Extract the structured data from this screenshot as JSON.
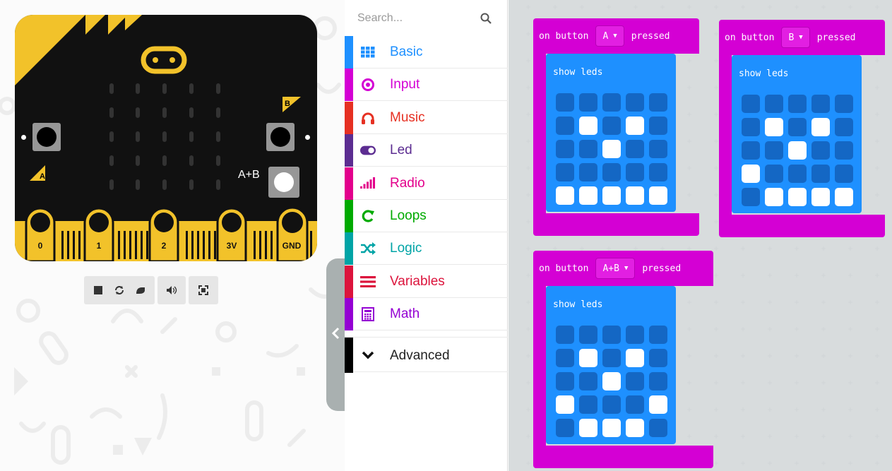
{
  "simulator": {
    "board_pins": [
      "0",
      "1",
      "2",
      "3V",
      "GND"
    ],
    "button_a_label": "A",
    "button_b_label": "B",
    "button_ab_label": "A+B",
    "colors": {
      "board": "#111111",
      "accent": "#f2c22a"
    },
    "toolbar_icons": [
      "stop-icon",
      "restart-icon",
      "slowmo-icon",
      "mute-icon",
      "fullscreen-icon"
    ]
  },
  "toolbox": {
    "search_placeholder": "Search...",
    "categories": [
      {
        "label": "Basic",
        "color": "#1e90ff",
        "icon": "grid-icon"
      },
      {
        "label": "Input",
        "color": "#d400d4",
        "icon": "target-icon"
      },
      {
        "label": "Music",
        "color": "#e63022",
        "icon": "headphones-icon"
      },
      {
        "label": "Led",
        "color": "#5c2d91",
        "icon": "toggle-icon"
      },
      {
        "label": "Radio",
        "color": "#e3008c",
        "icon": "signal-icon"
      },
      {
        "label": "Loops",
        "color": "#00aa00",
        "icon": "loop-icon"
      },
      {
        "label": "Logic",
        "color": "#00a4a6",
        "icon": "shuffle-icon"
      },
      {
        "label": "Variables",
        "color": "#dc143c",
        "icon": "list-icon"
      },
      {
        "label": "Math",
        "color": "#9400d3",
        "icon": "calculator-icon"
      }
    ],
    "advanced": {
      "label": "Advanced",
      "color": "#000000",
      "icon": "chevron-down-icon"
    }
  },
  "workspace": {
    "blocks": [
      {
        "prefix": "on button",
        "button": "A",
        "suffix": "pressed",
        "inner_label": "show leds",
        "leds": [
          [
            0,
            0,
            0,
            0,
            0
          ],
          [
            0,
            1,
            0,
            1,
            0
          ],
          [
            0,
            0,
            1,
            0,
            0
          ],
          [
            0,
            0,
            0,
            0,
            0
          ],
          [
            1,
            1,
            1,
            1,
            1
          ]
        ]
      },
      {
        "prefix": "on button",
        "button": "B",
        "suffix": "pressed",
        "inner_label": "show leds",
        "leds": [
          [
            0,
            0,
            0,
            0,
            0
          ],
          [
            0,
            1,
            0,
            1,
            0
          ],
          [
            0,
            0,
            1,
            0,
            0
          ],
          [
            1,
            0,
            0,
            0,
            0
          ],
          [
            0,
            1,
            1,
            1,
            1
          ]
        ]
      },
      {
        "prefix": "on button",
        "button": "A+B",
        "suffix": "pressed",
        "inner_label": "show leds",
        "leds": [
          [
            0,
            0,
            0,
            0,
            0
          ],
          [
            0,
            1,
            0,
            1,
            0
          ],
          [
            0,
            0,
            1,
            0,
            0
          ],
          [
            1,
            0,
            0,
            0,
            1
          ],
          [
            0,
            1,
            1,
            1,
            0
          ]
        ]
      }
    ],
    "colors": {
      "event": "#d400d4",
      "basic": "#1e90ff",
      "led_off": "#1467c4",
      "led_on": "#ffffff"
    }
  }
}
